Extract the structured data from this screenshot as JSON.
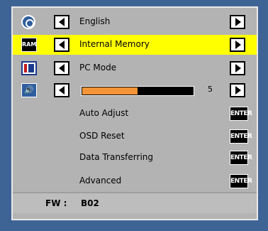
{
  "menu": {
    "language": {
      "label": "English",
      "icon": "globe-icon"
    },
    "storage": {
      "label": "Internal Memory",
      "icon_text": "RAM",
      "icon": "ram-icon"
    },
    "mode": {
      "label": "PC Mode",
      "icon": "pc-mode-icon"
    },
    "volume": {
      "value": "5",
      "fraction": 0.5,
      "icon": "speaker-icon"
    },
    "auto_adjust": {
      "label": "Auto Adjust",
      "button": "ENTER"
    },
    "osd_reset": {
      "label": "OSD Reset",
      "button": "ENTER"
    },
    "data_transfer": {
      "label": "Data Transferring",
      "button": "ENTER"
    },
    "advanced": {
      "label": "Advanced",
      "button": "ENTER"
    }
  },
  "footer": {
    "fw_label": "FW :",
    "fw_value": "B02"
  },
  "colors": {
    "background": "#3e6496",
    "panel": "#b3b3b3",
    "highlight": "#ffff00",
    "slider_fill": "#f39437"
  }
}
